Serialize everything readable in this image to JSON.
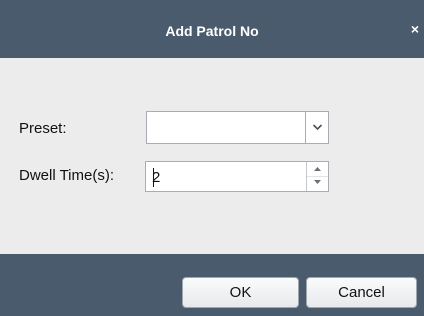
{
  "dialog": {
    "title": "Add Patrol No",
    "close_glyph": "×",
    "close_icon": "close-icon"
  },
  "form": {
    "preset": {
      "label": "Preset:",
      "value": "",
      "icon": "chevron-down-icon"
    },
    "dwell": {
      "label": "Dwell Time(s):",
      "value": "2",
      "icons": [
        "spin-up-icon",
        "spin-down-icon"
      ]
    }
  },
  "buttons": {
    "ok_label": "OK",
    "cancel_label": "Cancel"
  },
  "colors": {
    "title_bar": "#4b5b6e",
    "body": "#ececed",
    "footer": "#4b5b6e",
    "border": "#a9adb3"
  }
}
